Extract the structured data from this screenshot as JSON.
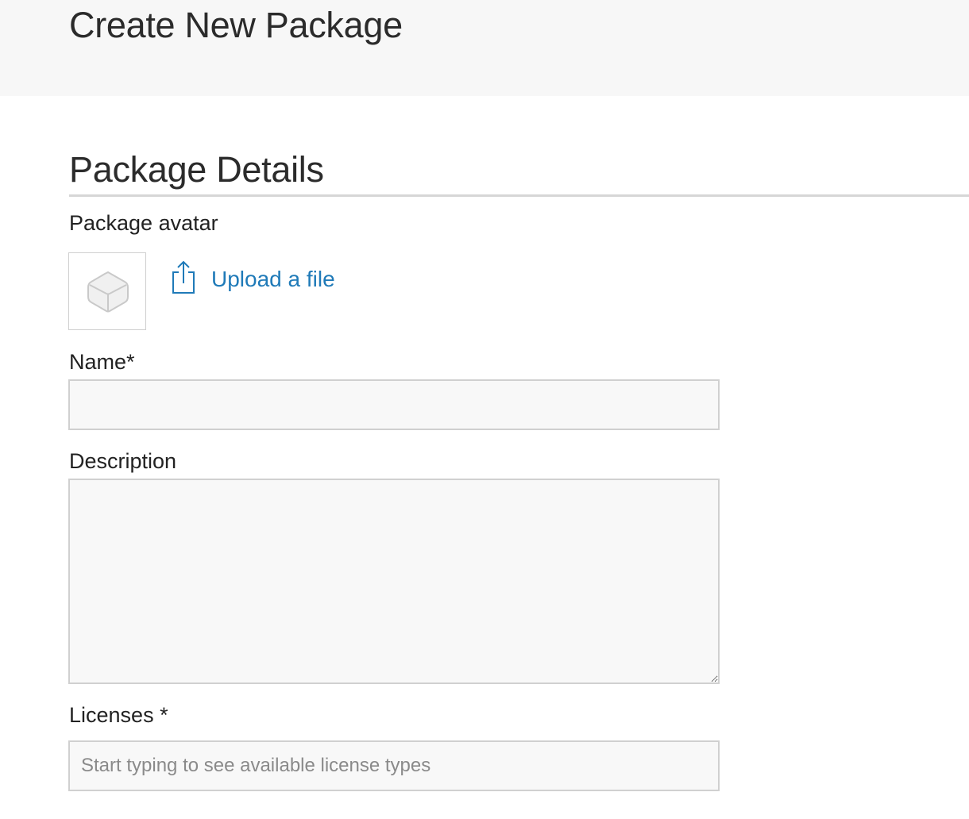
{
  "header": {
    "title": "Create New Package"
  },
  "section": {
    "title": "Package Details"
  },
  "avatar": {
    "label": "Package avatar",
    "placeholder_icon": "package-box-icon",
    "upload_icon": "share-upload-icon",
    "upload_label": "Upload a file"
  },
  "form": {
    "name_label": "Name*",
    "name_value": "",
    "name_placeholder": "",
    "description_label": "Description",
    "description_value": "",
    "licenses_label": "Licenses *",
    "licenses_placeholder": "Start typing to see available license types"
  },
  "colors": {
    "link": "#1f7ab8",
    "header_bg": "#f7f7f7",
    "field_bg": "#f8f8f8",
    "field_border": "#d0d0d0"
  }
}
